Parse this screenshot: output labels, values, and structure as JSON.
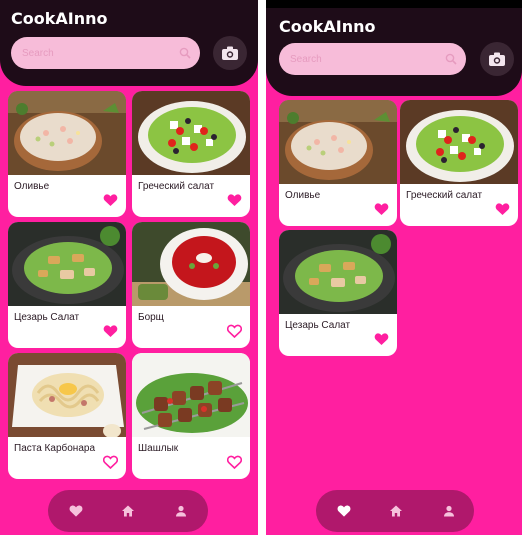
{
  "app": {
    "title": "CookAInno"
  },
  "search": {
    "placeholder": "Search"
  },
  "colors": {
    "background": "#ff1fa0",
    "header": "#1e0c18",
    "search_field": "#f7bcd9",
    "heart": "#ff1fa0",
    "nav_bar": "#b0186c",
    "card": "#ffffff"
  },
  "left_screen": {
    "recipes": [
      {
        "name": "Оливье",
        "favorite": true,
        "image": "olivier-salad"
      },
      {
        "name": "Греческий салат",
        "favorite": true,
        "image": "greek-salad"
      },
      {
        "name": "Цезарь Салат",
        "favorite": true,
        "image": "caesar-salad"
      },
      {
        "name": "Борщ",
        "favorite": false,
        "image": "borscht"
      },
      {
        "name": "Паста Карбонара",
        "favorite": false,
        "image": "pasta-carbonara"
      },
      {
        "name": "Шашлык",
        "favorite": false,
        "image": "shashlik"
      }
    ]
  },
  "right_screen": {
    "recipes": [
      {
        "name": "Оливье",
        "favorite": true,
        "image": "olivier-salad"
      },
      {
        "name": "Греческий салат",
        "favorite": true,
        "image": "greek-salad"
      },
      {
        "name": "Цезарь Салат",
        "favorite": true,
        "image": "caesar-salad"
      }
    ]
  },
  "nav": {
    "items": [
      {
        "icon": "heart-icon"
      },
      {
        "icon": "home-icon"
      },
      {
        "icon": "person-icon"
      }
    ]
  }
}
